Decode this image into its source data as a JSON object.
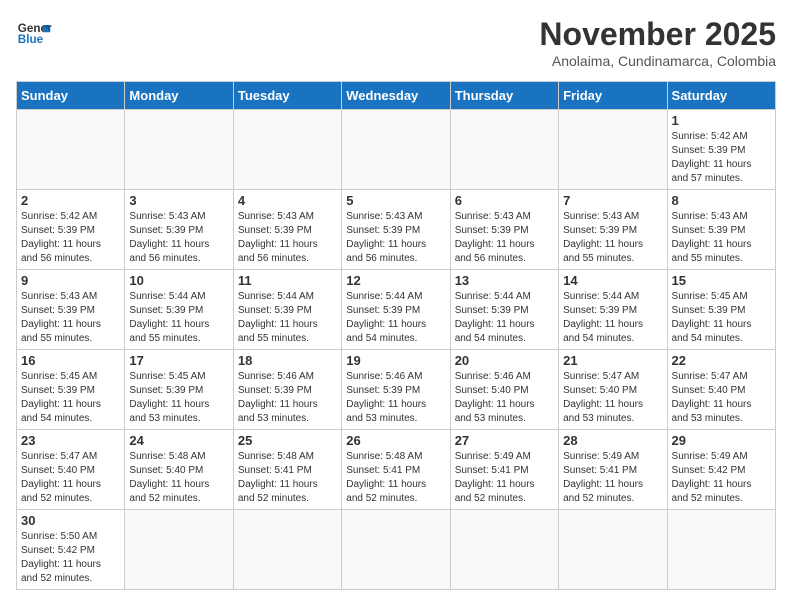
{
  "logo": {
    "line1": "General",
    "line2": "Blue"
  },
  "title": "November 2025",
  "subtitle": "Anolaima, Cundinamarca, Colombia",
  "weekdays": [
    "Sunday",
    "Monday",
    "Tuesday",
    "Wednesday",
    "Thursday",
    "Friday",
    "Saturday"
  ],
  "weeks": [
    [
      {
        "day": "",
        "info": ""
      },
      {
        "day": "",
        "info": ""
      },
      {
        "day": "",
        "info": ""
      },
      {
        "day": "",
        "info": ""
      },
      {
        "day": "",
        "info": ""
      },
      {
        "day": "",
        "info": ""
      },
      {
        "day": "1",
        "info": "Sunrise: 5:42 AM\nSunset: 5:39 PM\nDaylight: 11 hours\nand 57 minutes."
      }
    ],
    [
      {
        "day": "2",
        "info": "Sunrise: 5:42 AM\nSunset: 5:39 PM\nDaylight: 11 hours\nand 56 minutes."
      },
      {
        "day": "3",
        "info": "Sunrise: 5:43 AM\nSunset: 5:39 PM\nDaylight: 11 hours\nand 56 minutes."
      },
      {
        "day": "4",
        "info": "Sunrise: 5:43 AM\nSunset: 5:39 PM\nDaylight: 11 hours\nand 56 minutes."
      },
      {
        "day": "5",
        "info": "Sunrise: 5:43 AM\nSunset: 5:39 PM\nDaylight: 11 hours\nand 56 minutes."
      },
      {
        "day": "6",
        "info": "Sunrise: 5:43 AM\nSunset: 5:39 PM\nDaylight: 11 hours\nand 56 minutes."
      },
      {
        "day": "7",
        "info": "Sunrise: 5:43 AM\nSunset: 5:39 PM\nDaylight: 11 hours\nand 55 minutes."
      },
      {
        "day": "8",
        "info": "Sunrise: 5:43 AM\nSunset: 5:39 PM\nDaylight: 11 hours\nand 55 minutes."
      }
    ],
    [
      {
        "day": "9",
        "info": "Sunrise: 5:43 AM\nSunset: 5:39 PM\nDaylight: 11 hours\nand 55 minutes."
      },
      {
        "day": "10",
        "info": "Sunrise: 5:44 AM\nSunset: 5:39 PM\nDaylight: 11 hours\nand 55 minutes."
      },
      {
        "day": "11",
        "info": "Sunrise: 5:44 AM\nSunset: 5:39 PM\nDaylight: 11 hours\nand 55 minutes."
      },
      {
        "day": "12",
        "info": "Sunrise: 5:44 AM\nSunset: 5:39 PM\nDaylight: 11 hours\nand 54 minutes."
      },
      {
        "day": "13",
        "info": "Sunrise: 5:44 AM\nSunset: 5:39 PM\nDaylight: 11 hours\nand 54 minutes."
      },
      {
        "day": "14",
        "info": "Sunrise: 5:44 AM\nSunset: 5:39 PM\nDaylight: 11 hours\nand 54 minutes."
      },
      {
        "day": "15",
        "info": "Sunrise: 5:45 AM\nSunset: 5:39 PM\nDaylight: 11 hours\nand 54 minutes."
      }
    ],
    [
      {
        "day": "16",
        "info": "Sunrise: 5:45 AM\nSunset: 5:39 PM\nDaylight: 11 hours\nand 54 minutes."
      },
      {
        "day": "17",
        "info": "Sunrise: 5:45 AM\nSunset: 5:39 PM\nDaylight: 11 hours\nand 53 minutes."
      },
      {
        "day": "18",
        "info": "Sunrise: 5:46 AM\nSunset: 5:39 PM\nDaylight: 11 hours\nand 53 minutes."
      },
      {
        "day": "19",
        "info": "Sunrise: 5:46 AM\nSunset: 5:39 PM\nDaylight: 11 hours\nand 53 minutes."
      },
      {
        "day": "20",
        "info": "Sunrise: 5:46 AM\nSunset: 5:40 PM\nDaylight: 11 hours\nand 53 minutes."
      },
      {
        "day": "21",
        "info": "Sunrise: 5:47 AM\nSunset: 5:40 PM\nDaylight: 11 hours\nand 53 minutes."
      },
      {
        "day": "22",
        "info": "Sunrise: 5:47 AM\nSunset: 5:40 PM\nDaylight: 11 hours\nand 53 minutes."
      }
    ],
    [
      {
        "day": "23",
        "info": "Sunrise: 5:47 AM\nSunset: 5:40 PM\nDaylight: 11 hours\nand 52 minutes."
      },
      {
        "day": "24",
        "info": "Sunrise: 5:48 AM\nSunset: 5:40 PM\nDaylight: 11 hours\nand 52 minutes."
      },
      {
        "day": "25",
        "info": "Sunrise: 5:48 AM\nSunset: 5:41 PM\nDaylight: 11 hours\nand 52 minutes."
      },
      {
        "day": "26",
        "info": "Sunrise: 5:48 AM\nSunset: 5:41 PM\nDaylight: 11 hours\nand 52 minutes."
      },
      {
        "day": "27",
        "info": "Sunrise: 5:49 AM\nSunset: 5:41 PM\nDaylight: 11 hours\nand 52 minutes."
      },
      {
        "day": "28",
        "info": "Sunrise: 5:49 AM\nSunset: 5:41 PM\nDaylight: 11 hours\nand 52 minutes."
      },
      {
        "day": "29",
        "info": "Sunrise: 5:49 AM\nSunset: 5:42 PM\nDaylight: 11 hours\nand 52 minutes."
      }
    ],
    [
      {
        "day": "30",
        "info": "Sunrise: 5:50 AM\nSunset: 5:42 PM\nDaylight: 11 hours\nand 52 minutes."
      },
      {
        "day": "",
        "info": ""
      },
      {
        "day": "",
        "info": ""
      },
      {
        "day": "",
        "info": ""
      },
      {
        "day": "",
        "info": ""
      },
      {
        "day": "",
        "info": ""
      },
      {
        "day": "",
        "info": ""
      }
    ]
  ]
}
